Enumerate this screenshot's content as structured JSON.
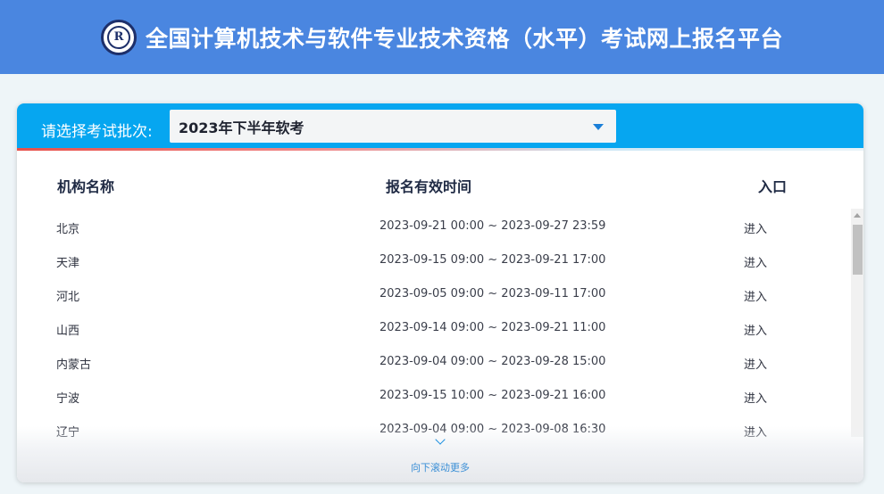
{
  "header": {
    "title": "全国计算机技术与软件专业技术资格（水平）考试网上报名平台"
  },
  "batch": {
    "label": "请选择考试批次:",
    "selected": "2023年下半年软考"
  },
  "table": {
    "columns": [
      "机构名称",
      "报名有效时间",
      "入口"
    ],
    "rows": [
      {
        "name": "北京",
        "time": "2023-09-21 00:00 ~ 2023-09-27 23:59",
        "action": "进入"
      },
      {
        "name": "天津",
        "time": "2023-09-15 09:00 ~ 2023-09-21 17:00",
        "action": "进入"
      },
      {
        "name": "河北",
        "time": "2023-09-05 09:00 ~ 2023-09-11 17:00",
        "action": "进入"
      },
      {
        "name": "山西",
        "time": "2023-09-14 09:00 ~ 2023-09-21 11:00",
        "action": "进入"
      },
      {
        "name": "内蒙古",
        "time": "2023-09-04 09:00 ~ 2023-09-28 15:00",
        "action": "进入"
      },
      {
        "name": "宁波",
        "time": "2023-09-15 10:00 ~ 2023-09-21 16:00",
        "action": "进入"
      },
      {
        "name": "辽宁",
        "time": "2023-09-04 09:00 ~ 2023-09-08 16:30",
        "action": "进入"
      }
    ]
  },
  "footer": {
    "scroll_hint": "向下滚动更多"
  },
  "colors": {
    "topbar": "#4a86e0",
    "card_header": "#06a6f0",
    "accent_line": "#e8504a"
  }
}
